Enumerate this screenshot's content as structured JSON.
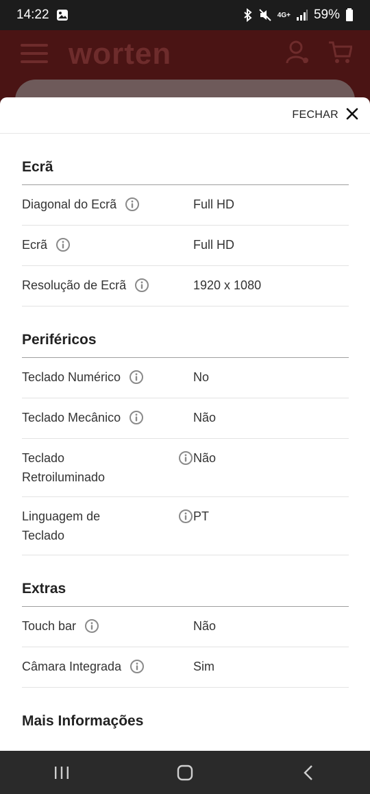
{
  "status": {
    "time": "14:22",
    "battery": "59%",
    "network": "4G+"
  },
  "app": {
    "logo": "worten"
  },
  "sheet": {
    "close_label": "FECHAR",
    "sections": [
      {
        "title": "Ecrã",
        "rows": [
          {
            "label": "Diagonal do Ecrã",
            "value": "Full HD"
          },
          {
            "label": "Ecrã",
            "value": "Full HD"
          },
          {
            "label": "Resolução de Ecrã",
            "value": "1920 x 1080"
          }
        ]
      },
      {
        "title": "Periféricos",
        "rows": [
          {
            "label": "Teclado Numérico",
            "value": "No"
          },
          {
            "label": "Teclado Mecânico",
            "value": "Não"
          },
          {
            "label": "Teclado Retroiluminado",
            "value": "Não"
          },
          {
            "label": "Linguagem de Teclado",
            "value": "PT"
          }
        ]
      },
      {
        "title": "Extras",
        "rows": [
          {
            "label": "Touch bar",
            "value": "Não"
          },
          {
            "label": "Câmara Integrada",
            "value": "Sim"
          }
        ]
      },
      {
        "title": "Mais Informações",
        "rows": []
      }
    ]
  },
  "icons": {
    "info": "info-circle-icon",
    "close": "close-icon"
  },
  "colors": {
    "brand_red": "#c8102e",
    "overlay": "#5b1a1a"
  }
}
